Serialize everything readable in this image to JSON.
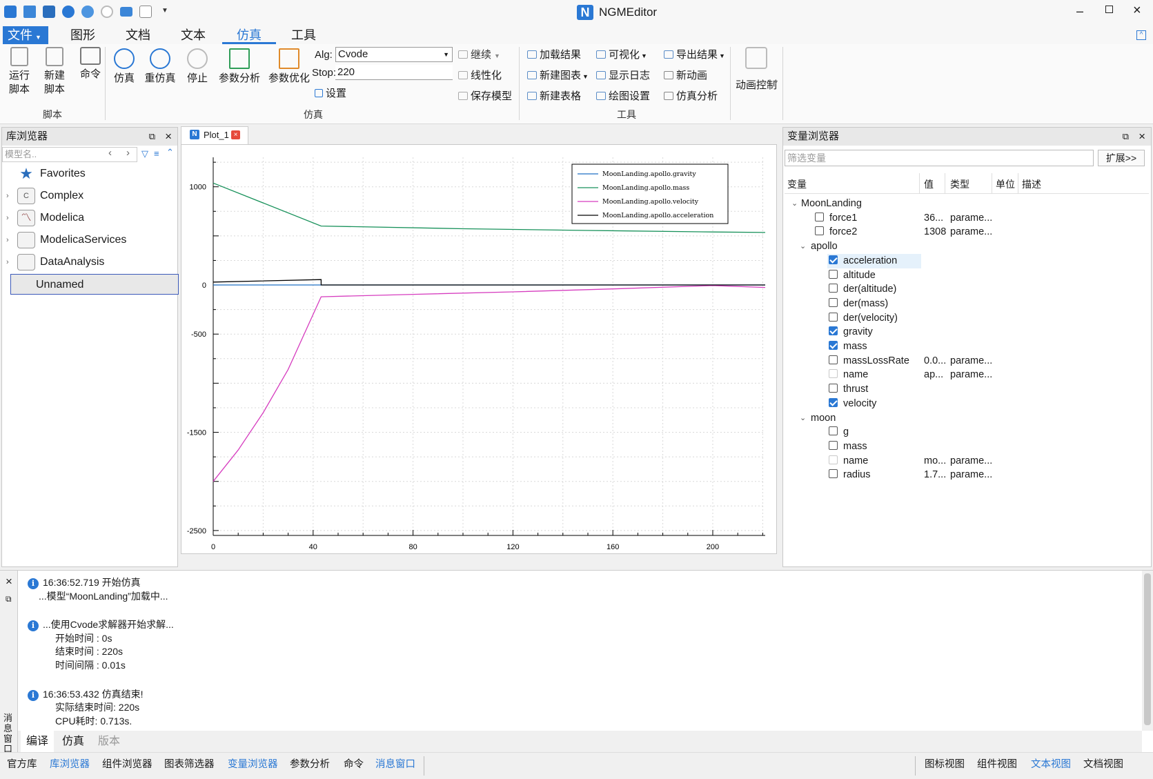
{
  "app": {
    "title": "NGMEditor",
    "window_controls": [
      "minimize-icon",
      "maximize-icon",
      "close-icon"
    ]
  },
  "menu": {
    "file": "文件",
    "items": [
      "图形",
      "文档",
      "文本",
      "仿真",
      "工具"
    ],
    "active": "仿真"
  },
  "ribbon": {
    "script": {
      "run": [
        "运行",
        "脚本"
      ],
      "new": [
        "新建",
        "脚本"
      ],
      "cmd": "命令",
      "group": "脚本"
    },
    "sim": {
      "simulate": "仿真",
      "resim": "重仿真",
      "stop": "停止",
      "param_analysis": "参数分析",
      "param_opt": "参数优化",
      "alg_label": "Alg:",
      "alg_value": "Cvode",
      "stop_label": "Stop:",
      "stop_value": "220",
      "settings": "设置",
      "continue": "继续",
      "linearize": "线性化",
      "save_model": "保存模型",
      "group": "仿真"
    },
    "tools": {
      "load_result": "加载结果",
      "new_chart": "新建图表",
      "new_table": "新建表格",
      "visualize": "可视化",
      "show_log": "显示日志",
      "plot_settings": "绘图设置",
      "export_result": "导出结果",
      "new_anim": "新动画",
      "sim_analysis": "仿真分析",
      "group": "工具"
    },
    "anim": {
      "label": "动画控制"
    }
  },
  "library": {
    "title": "库浏览器",
    "search_placeholder": "模型名..",
    "items": [
      {
        "label": "Favorites",
        "icon": "star-icon"
      },
      {
        "label": "Complex",
        "icon": "complex-icon",
        "badge": "C"
      },
      {
        "label": "Modelica",
        "icon": "modelica-icon"
      },
      {
        "label": "ModelicaServices",
        "icon": "package-icon"
      },
      {
        "label": "DataAnalysis",
        "icon": "package-icon"
      },
      {
        "label": "Unnamed",
        "icon": ""
      }
    ]
  },
  "plot_tab": {
    "label": "Plot_1"
  },
  "chart_data": {
    "type": "line",
    "xlim": [
      0,
      221
    ],
    "ylim": [
      -2550,
      1300
    ],
    "x_ticks": [
      0,
      40,
      80,
      120,
      160,
      200
    ],
    "y_ticks": [
      -2500,
      -1500,
      -500,
      0,
      1000
    ],
    "y_tick_labels": [
      "-2500",
      "-1500",
      "-500",
      "0",
      "1000"
    ],
    "x_tick_labels": [
      "0",
      "40",
      "80",
      "120",
      "160",
      "200"
    ],
    "grid": true,
    "legend_position": "top-right",
    "series": [
      {
        "name": "MoonLanding.apollo.gravity",
        "color": "#1f6fc4",
        "x": [
          0,
          221
        ],
        "y": [
          0,
          0
        ]
      },
      {
        "name": "MoonLanding.apollo.mass",
        "color": "#17915a",
        "x": [
          0,
          43.2,
          100,
          150,
          200,
          221
        ],
        "y": [
          1038,
          600,
          573,
          555,
          540,
          535
        ]
      },
      {
        "name": "MoonLanding.apollo.velocity",
        "color": "#d63cbf",
        "x": [
          0,
          10,
          20,
          30,
          43.2,
          80,
          120,
          160,
          200,
          221
        ],
        "y": [
          -2000,
          -1680,
          -1300,
          -860,
          -120,
          -95,
          -70,
          -40,
          -5,
          -25
        ]
      },
      {
        "name": "MoonLanding.apollo.acceleration",
        "color": "#000000",
        "x": [
          0,
          43.2,
          43.2,
          221
        ],
        "y": [
          30,
          55,
          0,
          0
        ]
      }
    ]
  },
  "variables": {
    "title": "变量浏览器",
    "filter_placeholder": "筛选变量",
    "expand": "扩展>>",
    "columns": [
      "变量",
      "值",
      "类型",
      "单位",
      "描述"
    ],
    "rows": [
      {
        "indent": 0,
        "kind": "group",
        "name": "MoonLanding"
      },
      {
        "indent": 2,
        "kind": "var",
        "name": "force1",
        "value": "36...",
        "type": "parame...",
        "checked": false
      },
      {
        "indent": 2,
        "kind": "var",
        "name": "force2",
        "value": "1308",
        "type": "parame...",
        "checked": false
      },
      {
        "indent": 1,
        "kind": "group",
        "name": "apollo"
      },
      {
        "indent": 3,
        "kind": "var",
        "name": "acceleration",
        "value": "",
        "type": "",
        "checked": true,
        "selected": true
      },
      {
        "indent": 3,
        "kind": "var",
        "name": "altitude",
        "value": "",
        "type": "",
        "checked": false
      },
      {
        "indent": 3,
        "kind": "var",
        "name": "der(altitude)",
        "value": "",
        "type": "",
        "checked": false
      },
      {
        "indent": 3,
        "kind": "var",
        "name": "der(mass)",
        "value": "",
        "type": "",
        "checked": false
      },
      {
        "indent": 3,
        "kind": "var",
        "name": "der(velocity)",
        "value": "",
        "type": "",
        "checked": false
      },
      {
        "indent": 3,
        "kind": "var",
        "name": "gravity",
        "value": "",
        "type": "",
        "checked": true
      },
      {
        "indent": 3,
        "kind": "var",
        "name": "mass",
        "value": "",
        "type": "",
        "checked": true
      },
      {
        "indent": 3,
        "kind": "var",
        "name": "massLossRate",
        "value": "0.0...",
        "type": "parame...",
        "checked": false
      },
      {
        "indent": 3,
        "kind": "var",
        "name": "name",
        "value": "ap...",
        "type": "parame...",
        "checked": false,
        "disabled": true
      },
      {
        "indent": 3,
        "kind": "var",
        "name": "thrust",
        "value": "",
        "type": "",
        "checked": false
      },
      {
        "indent": 3,
        "kind": "var",
        "name": "velocity",
        "value": "",
        "type": "",
        "checked": true
      },
      {
        "indent": 1,
        "kind": "group",
        "name": "moon"
      },
      {
        "indent": 3,
        "kind": "var",
        "name": "g",
        "value": "",
        "type": "",
        "checked": false
      },
      {
        "indent": 3,
        "kind": "var",
        "name": "mass",
        "value": "",
        "type": "",
        "checked": false
      },
      {
        "indent": 3,
        "kind": "var",
        "name": "name",
        "value": "mo...",
        "type": "parame...",
        "checked": false,
        "disabled": true
      },
      {
        "indent": 3,
        "kind": "var",
        "name": "radius",
        "value": "1.7...",
        "type": "parame...",
        "checked": false
      }
    ]
  },
  "messages": {
    "side_label": "消息窗口",
    "lines": [
      {
        "info": true,
        "text": "16:36:52.719  开始仿真"
      },
      {
        "info": false,
        "indent": 1,
        "text": "...模型“MoonLanding”加载中..."
      },
      {
        "info": false,
        "text": ""
      },
      {
        "info": true,
        "text": "...使用Cvode求解器开始求解..."
      },
      {
        "info": false,
        "indent": 2,
        "text": "开始时间    :  0s"
      },
      {
        "info": false,
        "indent": 2,
        "text": "结束时间    :  220s"
      },
      {
        "info": false,
        "indent": 2,
        "text": "时间间隔    :  0.01s"
      },
      {
        "info": false,
        "text": ""
      },
      {
        "info": true,
        "text": "16:36:53.432 仿真结束!"
      },
      {
        "info": false,
        "indent": 2,
        "text": "实际结束时间:  220s"
      },
      {
        "info": false,
        "indent": 2,
        "text": "CPU耗时: 0.713s."
      }
    ],
    "tabs": [
      "编译",
      "仿真",
      "版本"
    ]
  },
  "bottom": {
    "left_tabs": [
      "官方库",
      "库浏览器",
      "组件浏览器",
      "图表筛选器",
      "变量浏览器",
      "参数分析",
      "命令",
      "消息窗口"
    ],
    "left_active": [
      "库浏览器",
      "变量浏览器",
      "消息窗口"
    ],
    "right_tabs": [
      "图标视图",
      "组件视图",
      "文本视图",
      "文档视图"
    ],
    "right_active": [
      "文本视图"
    ]
  }
}
